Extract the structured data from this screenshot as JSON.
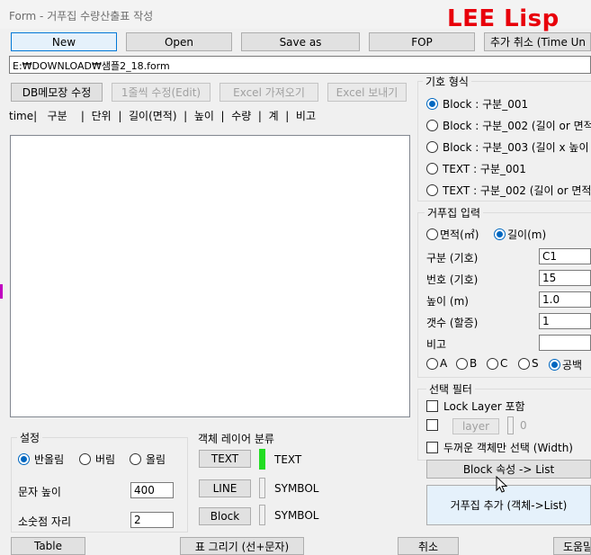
{
  "window": {
    "title": "Form - 거푸집 수량산출표 작성",
    "brand": "LEE Lisp"
  },
  "toolbar": {
    "new": "New",
    "open": "Open",
    "save_as": "Save as",
    "fop": "FOP",
    "undo_add": "추가 취소 (Time Un"
  },
  "file_path": "E:₩DOWNLOAD₩샘플2_18.form",
  "actions": {
    "db_memo": "DB메모장 수정",
    "edit_line": "1줄씩 수정(Edit)",
    "excel_import": "Excel 가져오기",
    "excel_export": "Excel 보내기"
  },
  "list_header": "time|   구분    |  단위  |  길이(면적)  |  높이  |  수량  |  계  |  비고",
  "symbol_type": {
    "title": "기호 형식",
    "options": [
      "Block : 구분_001",
      "Block : 구분_002 (길이 or 면적",
      "Block : 구분_003 (길이 x 높이",
      "TEXT : 구분_001",
      "TEXT : 구분_002 (길이 or 면적"
    ],
    "selected": 0
  },
  "formwork_input": {
    "title": "거푸집 입력",
    "mode_area": "면적(㎡)",
    "mode_length": "길이(m)",
    "fields": [
      {
        "label": "구분 (기호)",
        "value": "C1"
      },
      {
        "label": "번호 (기호)",
        "value": "15"
      },
      {
        "label": "높이 (m)",
        "value": "1.0"
      },
      {
        "label": "갯수 (할증)",
        "value": "1"
      },
      {
        "label": "비고",
        "value": ""
      }
    ],
    "abc_options": [
      "A",
      "B",
      "C",
      "S",
      "공백"
    ],
    "abc_selected": 4
  },
  "selection_filter": {
    "title": "선택 필터",
    "lock_layer": "Lock Layer 포함",
    "layer_button": "layer",
    "layer_value": "0",
    "thick_only": "두꺼운 객체만 선택 (Width)"
  },
  "block_attr_button": "Block 속성 -> List",
  "add_formwork_button": "거푸집 추가  (객체->List)",
  "settings": {
    "title": "설정",
    "rounding": [
      "반올림",
      "버림",
      "올림"
    ],
    "rounding_selected": 0,
    "text_height_label": "문자 높이",
    "text_height_value": "400",
    "decimals_label": "소숫점 자리",
    "decimals_value": "2"
  },
  "layer_class": {
    "title": "객체 레이어 분류",
    "rows": [
      {
        "button": "TEXT",
        "name": "TEXT"
      },
      {
        "button": "LINE",
        "name": "SYMBOL"
      },
      {
        "button": "Block",
        "name": "SYMBOL"
      }
    ]
  },
  "bottom": {
    "table": "Table",
    "draw_table": "표 그리기 (선+문자)",
    "cancel": "취소",
    "help": "도움말"
  },
  "colors": {
    "brand": "#e8000b",
    "accent": "#0067c0",
    "text_layer_swatch": "#22dd22"
  }
}
